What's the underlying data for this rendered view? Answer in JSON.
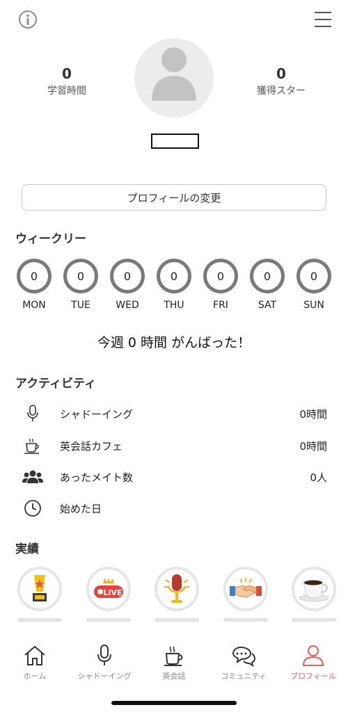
{
  "header": {
    "info_icon": "info-icon",
    "menu_icon": "menu-icon"
  },
  "stats": {
    "study_time": {
      "value": "0",
      "label": "学習時間"
    },
    "stars": {
      "value": "0",
      "label": "獲得スター"
    }
  },
  "profile": {
    "edit_button": "プロフィールの変更"
  },
  "weekly": {
    "title": "ウィークリー",
    "days": [
      {
        "count": "0",
        "label": "MON"
      },
      {
        "count": "0",
        "label": "TUE"
      },
      {
        "count": "0",
        "label": "WED"
      },
      {
        "count": "0",
        "label": "THU"
      },
      {
        "count": "0",
        "label": "FRI"
      },
      {
        "count": "0",
        "label": "SAT"
      },
      {
        "count": "0",
        "label": "SUN"
      }
    ],
    "message": "今週 0 時間 がんばった！"
  },
  "activity": {
    "title": "アクティビティ",
    "items": [
      {
        "icon": "microphone-icon",
        "label": "シャドーイング",
        "value": "0時間"
      },
      {
        "icon": "coffee-cup-icon",
        "label": "英会話カフェ",
        "value": "0時間"
      },
      {
        "icon": "people-icon",
        "label": "あったメイト数",
        "value": "0人"
      },
      {
        "icon": "clock-icon",
        "label": "始めた日",
        "value": ""
      }
    ]
  },
  "achievements": {
    "title": "実績",
    "badges": [
      {
        "icon": "trophy-icon"
      },
      {
        "icon": "live-icon",
        "text": "LIVE"
      },
      {
        "icon": "microphone-badge-icon"
      },
      {
        "icon": "handshake-icon"
      },
      {
        "icon": "coffee-badge-icon"
      }
    ]
  },
  "tabbar": {
    "active_color": "#e85a55",
    "tabs": [
      {
        "label": "ホーム",
        "icon": "home-icon"
      },
      {
        "label": "シャドーイング",
        "icon": "microphone-icon"
      },
      {
        "label": "英会話",
        "icon": "coffee-cup-icon"
      },
      {
        "label": "コミュニティ",
        "icon": "chat-bubbles-icon"
      },
      {
        "label": "プロフィール",
        "icon": "person-icon",
        "active": true
      }
    ]
  }
}
